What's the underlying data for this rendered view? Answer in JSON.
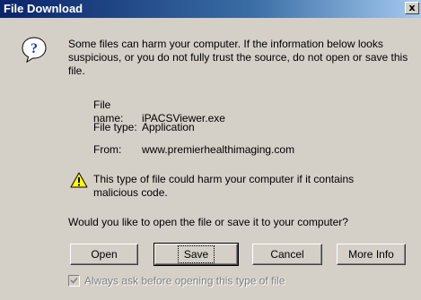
{
  "window": {
    "title": "File Download",
    "close_glyph": "x"
  },
  "message": "Some files can harm your computer. If the information below looks suspicious, or you do not fully trust the source, do not open or save this file.",
  "file_info": {
    "name_label": "File name:",
    "name_value": "iPACSViewer.exe",
    "type_label": "File type:",
    "type_value": "Application",
    "from_label": "From:",
    "from_value": "www.premierhealthimaging.com"
  },
  "danger_message": "This type of file could harm your computer if it contains malicious code.",
  "question": "Would you like to open the file or save it to your computer?",
  "buttons": {
    "open": "Open",
    "save": "Save",
    "cancel": "Cancel",
    "more_info": "More Info"
  },
  "checkbox": {
    "label": "Always ask before opening this type of file",
    "checked": true,
    "disabled": true
  },
  "icons": {
    "question": "question-icon",
    "warning": "warning-triangle-icon",
    "close": "close-icon"
  },
  "colors": {
    "face": "#d4d0c8",
    "title_start": "#0a246a",
    "title_end": "#a6caf0",
    "warning_yellow": "#ffff00"
  }
}
